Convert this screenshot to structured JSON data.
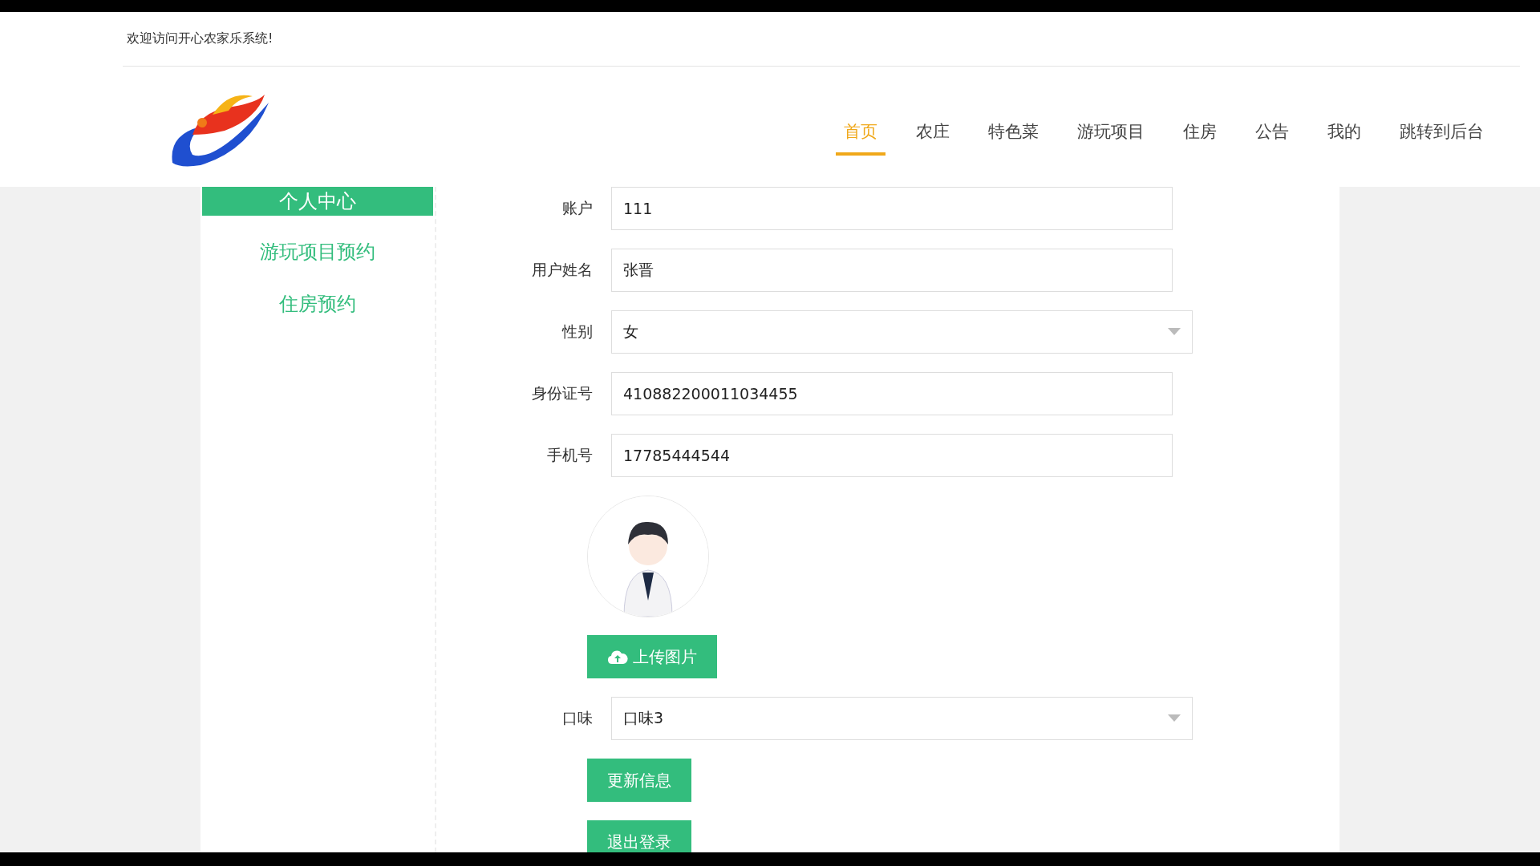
{
  "welcome": "欢迎访问开心农家乐系统!",
  "nav": [
    {
      "label": "首页",
      "selected": true
    },
    {
      "label": "农庄",
      "selected": false
    },
    {
      "label": "特色菜",
      "selected": false
    },
    {
      "label": "游玩项目",
      "selected": false
    },
    {
      "label": "住房",
      "selected": false
    },
    {
      "label": "公告",
      "selected": false
    },
    {
      "label": "我的",
      "selected": false
    },
    {
      "label": "跳转到后台",
      "selected": false
    }
  ],
  "sidebar": {
    "title": "个人中心",
    "items": [
      {
        "label": "游玩项目预约"
      },
      {
        "label": "住房预约"
      }
    ]
  },
  "form": {
    "fields": [
      {
        "kind": "input",
        "label": "账户",
        "value": "111"
      },
      {
        "kind": "input",
        "label": "用户姓名",
        "value": "张晋"
      },
      {
        "kind": "select",
        "label": "性别",
        "value": "女"
      },
      {
        "kind": "input",
        "label": "身份证号",
        "value": "410882200011034455"
      },
      {
        "kind": "input",
        "label": "手机号",
        "value": "17785444544"
      },
      {
        "kind": "avatar",
        "button": "上传图片"
      },
      {
        "kind": "select",
        "label": "口味",
        "value": "口味3"
      }
    ],
    "buttons": [
      "更新信息",
      "退出登录"
    ]
  }
}
